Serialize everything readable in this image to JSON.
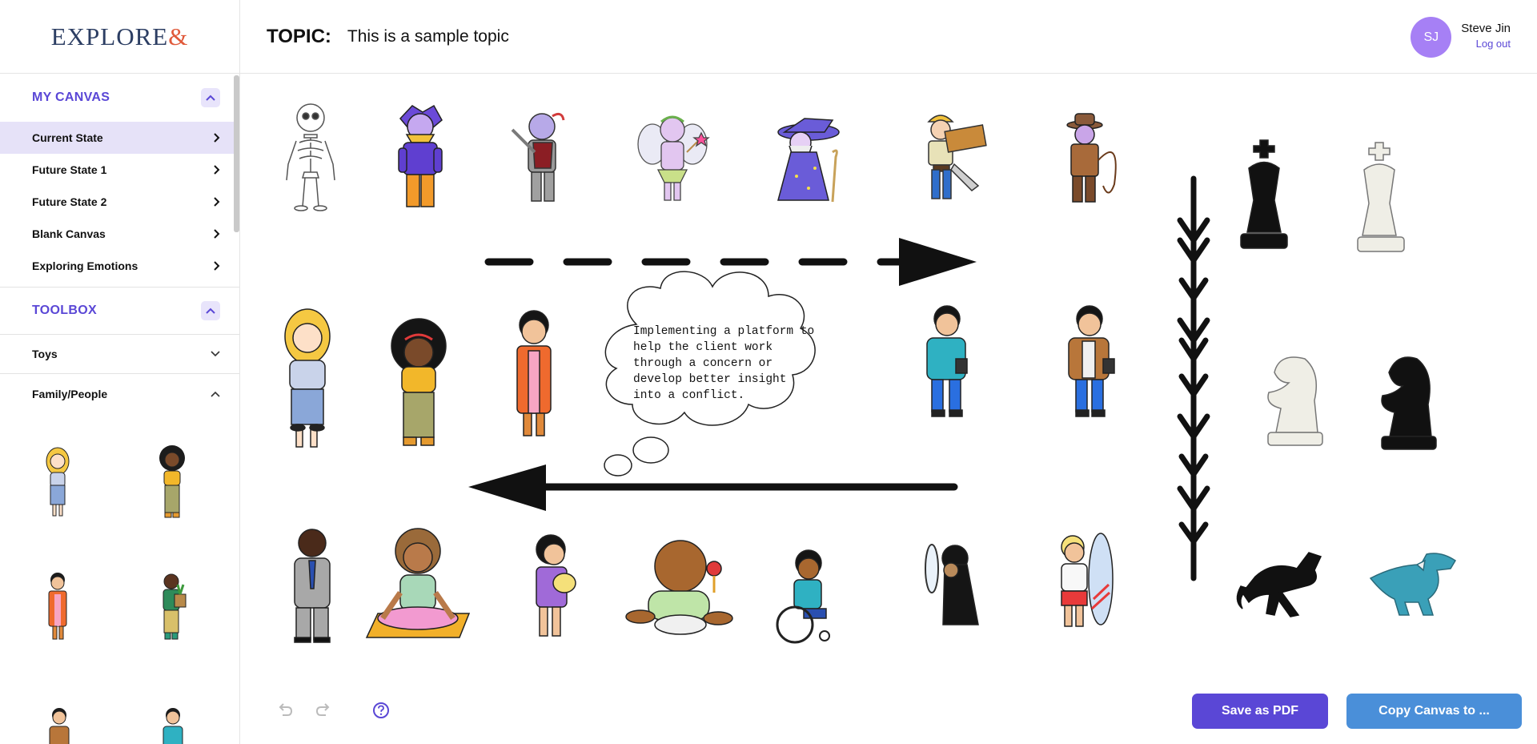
{
  "app": {
    "logo_text": "EXPLORE",
    "logo_amp": "&"
  },
  "header": {
    "topic_label": "TOPIC:",
    "topic_value": "This is a sample topic"
  },
  "user": {
    "initials": "SJ",
    "name": "Steve Jin",
    "logout_label": "Log out"
  },
  "sidebar": {
    "my_canvas": {
      "title": "MY CANVAS",
      "items": [
        {
          "label": "Current State",
          "active": true
        },
        {
          "label": "Future State 1"
        },
        {
          "label": "Future State 2"
        },
        {
          "label": "Blank Canvas"
        },
        {
          "label": "Exploring Emotions"
        }
      ]
    },
    "toolbox": {
      "title": "TOOLBOX",
      "categories": [
        {
          "label": "Toys",
          "expanded": false
        },
        {
          "label": "Family/People",
          "expanded": true
        }
      ]
    }
  },
  "canvas": {
    "thought_bubble_text": "Implementing a platform to help the client work through a concern or develop better insight into a conflict."
  },
  "footer": {
    "save_pdf_label": "Save as PDF",
    "copy_canvas_label": "Copy Canvas to ..."
  },
  "colors": {
    "accent": "#5a47d6",
    "secondary": "#4a8fd9",
    "avatar": "#a680f5"
  }
}
